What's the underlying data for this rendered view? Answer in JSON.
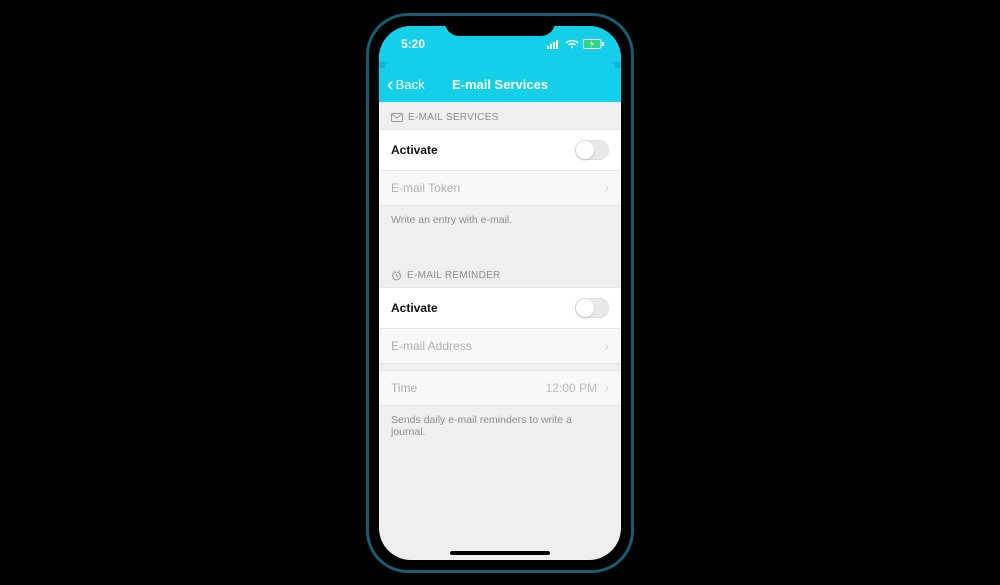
{
  "status": {
    "time": "5:20"
  },
  "nav": {
    "back": "Back",
    "title": "E-mail Services"
  },
  "section1": {
    "header": "E-MAIL SERVICES",
    "activate": "Activate",
    "token": "E-mail Token",
    "footer": "Write an entry with e-mail."
  },
  "section2": {
    "header": "E-MAIL REMINDER",
    "activate": "Activate",
    "address": "E-mail Address",
    "time_label": "Time",
    "time_value": "12:00 PM",
    "footer": "Sends daily e-mail reminders to write a journal."
  }
}
